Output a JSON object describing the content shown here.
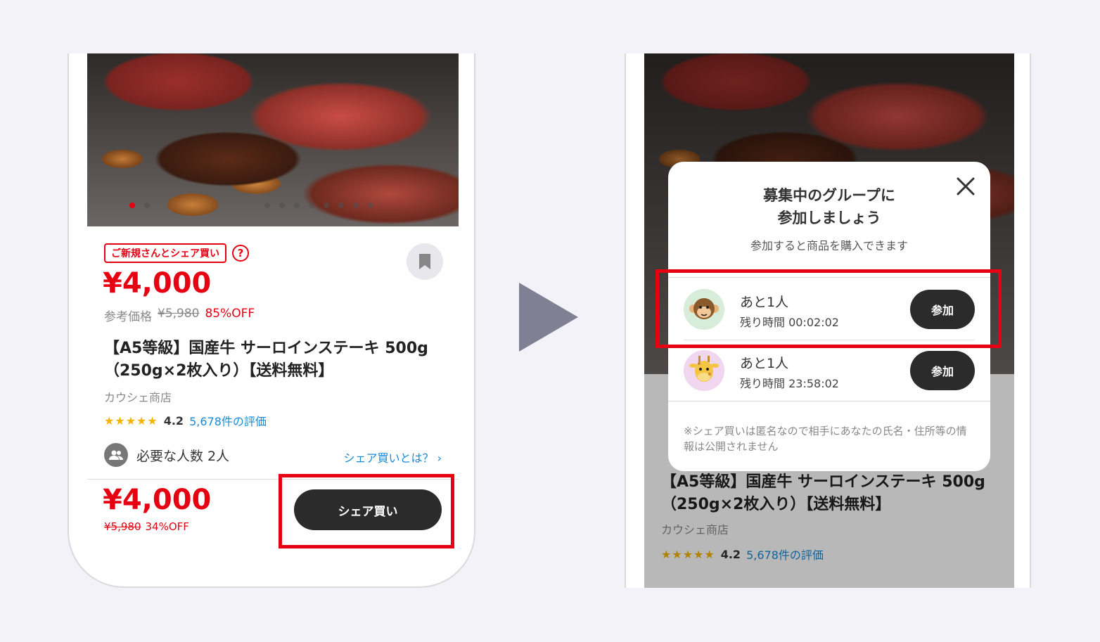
{
  "left_screen": {
    "badge_label": "ご新規さんとシェア買い",
    "help_symbol": "?",
    "price": "¥4,000",
    "ref_price_label": "参考価格",
    "ref_price": "¥5,980",
    "discount": "85%OFF",
    "title": "【A5等級】国産牛 サーロインステーキ 500g（250g×2枚入り）【送料無料】",
    "shop": "カウシェ商店",
    "stars": "★★★★★",
    "rating": "4.2",
    "reviews": "5,678件の評価",
    "people_required": "必要な人数 2人",
    "whatis_link": "シェア買いとは？ ›",
    "bottom_price": "¥4,000",
    "bottom_ref_price": "¥5,980",
    "bottom_discount": "34%OFF",
    "share_button": "シェア買い"
  },
  "right_screen": {
    "modal_title_line1": "募集中のグループに",
    "modal_title_line2": "参加しましょう",
    "modal_subtitle": "参加すると商品を購入できます",
    "groups": [
      {
        "need": "あと1人",
        "time": "残り時間 00:02:02",
        "join": "参加",
        "avatar": "monkey"
      },
      {
        "need": "あと1人",
        "time": "残り時間 23:58:02",
        "join": "参加",
        "avatar": "giraffe"
      }
    ],
    "note": "※シェア買いは匿名なので相手にあなたの氏名・住所等の情報は公開されません",
    "bg_title": "【A5等級】国産牛 サーロインステーキ 500g（250g×2枚入り）【送料無料】",
    "bg_shop": "カウシェ商店",
    "bg_stars": "★★★★★",
    "bg_rating": "4.2",
    "bg_reviews": "5,678件の評価"
  },
  "colors": {
    "accent_red": "#e60012",
    "button_dark": "#2b2b2b",
    "link_blue": "#1a8ad4",
    "arrow_gray": "#7f8094"
  }
}
